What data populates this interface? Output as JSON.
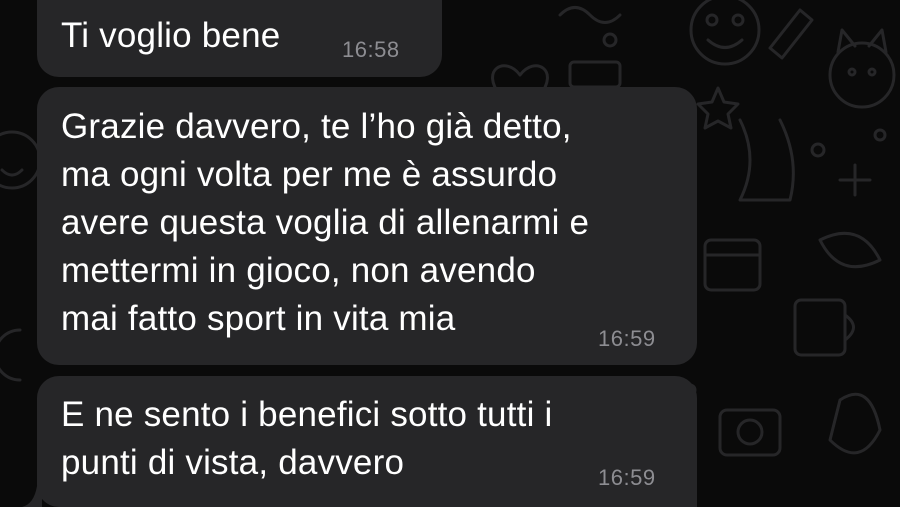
{
  "messages": [
    {
      "text": "Ti voglio bene",
      "time": "16:58"
    },
    {
      "text": "Grazie davvero, te l’ho già detto,\nma ogni volta per me è assurdo\navere questa voglia di allenarmi e\nmettermi in gioco, non avendo\nmai fatto sport in vita mia",
      "time": "16:59"
    },
    {
      "text": "E ne sento i benefici sotto tutti i\npunti di vista, davvero",
      "time": "16:59"
    }
  ],
  "colors": {
    "background": "#0a0a0a",
    "bubble": "#262628",
    "message_text": "#ffffff",
    "timestamp": "#8d8d92",
    "doodle": "#2a2a2c"
  }
}
